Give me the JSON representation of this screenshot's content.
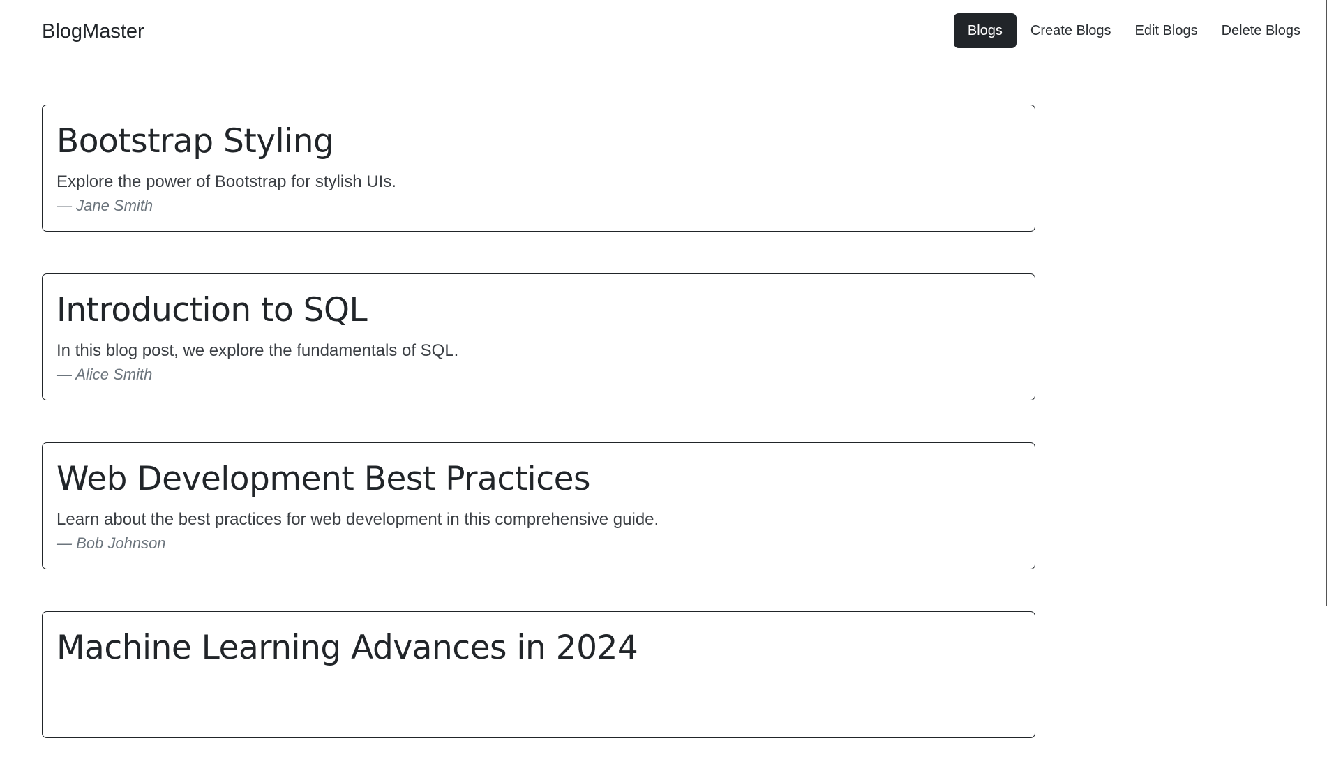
{
  "navbar": {
    "brand": "BlogMaster",
    "links": [
      {
        "label": "Blogs",
        "active": true
      },
      {
        "label": "Create Blogs",
        "active": false
      },
      {
        "label": "Edit Blogs",
        "active": false
      },
      {
        "label": "Delete Blogs",
        "active": false
      }
    ]
  },
  "blogs": [
    {
      "title": "Bootstrap Styling",
      "description": "Explore the power of Bootstrap for stylish UIs.",
      "author": "— Jane Smith"
    },
    {
      "title": "Introduction to SQL",
      "description": "In this blog post, we explore the fundamentals of SQL.",
      "author": "— Alice Smith"
    },
    {
      "title": "Web Development Best Practices",
      "description": "Learn about the best practices for web development in this comprehensive guide.",
      "author": "— Bob Johnson"
    },
    {
      "title": "Machine Learning Advances in 2024",
      "description": "",
      "author": ""
    }
  ],
  "colors": {
    "active_nav_bg": "#212529",
    "card_border": "#212529",
    "author_text": "#6c757d"
  }
}
